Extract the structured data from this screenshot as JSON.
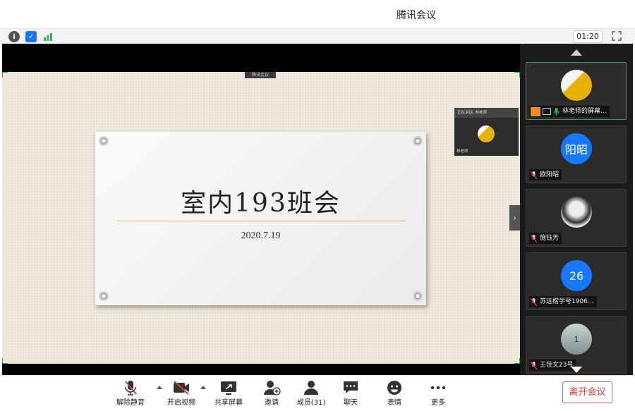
{
  "window": {
    "title": "腾讯会议"
  },
  "status": {
    "timer": "01:20"
  },
  "share_tag": "腾讯会议",
  "slide": {
    "title": "室内193班会",
    "date": "2020.7.19"
  },
  "speaker": {
    "header": "正在讲话: 林老师",
    "name": "林老师"
  },
  "participants": [
    {
      "name": "林老师的屏幕...",
      "avatar_text": ""
    },
    {
      "name": "欧阳昭",
      "avatar_text": "阳昭"
    },
    {
      "name": "施钰芳",
      "avatar_text": ""
    },
    {
      "name": "苏远楷学号1906...",
      "avatar_text": "26"
    },
    {
      "name": "王佳文23号",
      "avatar_text": "1"
    }
  ],
  "toolbar": {
    "unmute": "解除静音",
    "start_video": "开启视频",
    "share_screen": "共享屏幕",
    "invite": "邀请",
    "members": "成员(31)",
    "chat": "聊天",
    "emoji": "表情",
    "more": "更多",
    "leave": "离开会议"
  },
  "colors": {
    "accent": "#1677ff",
    "leave": "#e03a3a",
    "active_border": "#3b9e5b"
  }
}
